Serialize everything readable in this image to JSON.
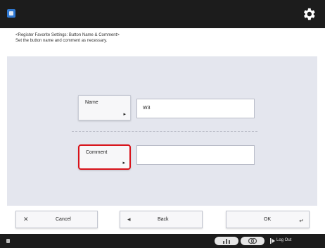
{
  "topbar": {
    "app_icon": "app-badge-icon",
    "settings_icon": "gear-icon"
  },
  "header": {
    "title": "<Register Favorite Settings: Button Name & Comment>",
    "subtitle": "Set the button name and comment as necessary."
  },
  "form": {
    "name_label": "Name",
    "name_value": "W3",
    "comment_label": "Comment",
    "comment_value": "",
    "highlight_color": "#d8121a"
  },
  "buttons": {
    "cancel_label": "Cancel",
    "back_label": "Back",
    "ok_label": "OK"
  },
  "statusbar": {
    "logout_label": "Log Out"
  }
}
